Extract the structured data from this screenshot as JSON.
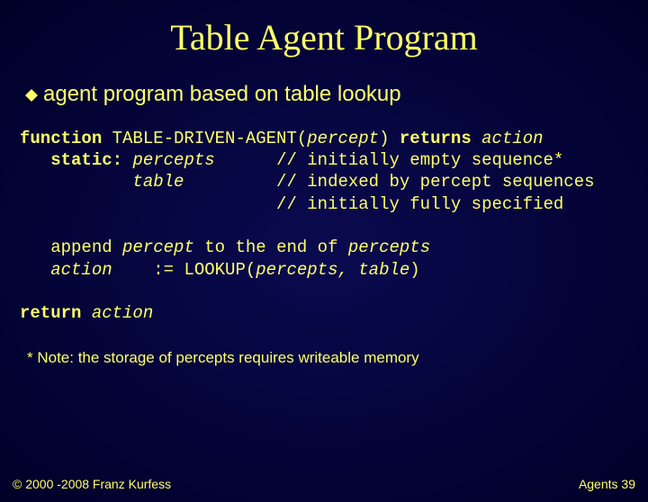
{
  "slide": {
    "title": "Table Agent Program",
    "bullet": "agent program based on table lookup",
    "code": {
      "l1a": "function",
      "l1b": " TABLE-DRIVEN-AGENT(",
      "l1c": "percept",
      "l1d": ") ",
      "l1e": "returns",
      "l1f": " ",
      "l1g": "action",
      "l2a": "   static:",
      "l2b": " ",
      "l2c": "percepts",
      "l2d": "      // initially empty sequence*",
      "l3a": "           ",
      "l3b": "table",
      "l3c": "         // indexed by percept sequences",
      "l4": "                         // initially fully specified",
      "l5a": "   append ",
      "l5b": "percept",
      "l5c": " to the end of ",
      "l5d": "percepts",
      "l6a": "   action",
      "l6b": "    := LOOKUP(",
      "l6c": "percepts, table",
      "l6d": ")",
      "l7a": "return",
      "l7b": " ",
      "l7c": "action"
    },
    "note": "* Note: the storage of percepts requires writeable memory",
    "footer_left": "© 2000 -2008 Franz Kurfess",
    "footer_right": "Agents  39"
  }
}
